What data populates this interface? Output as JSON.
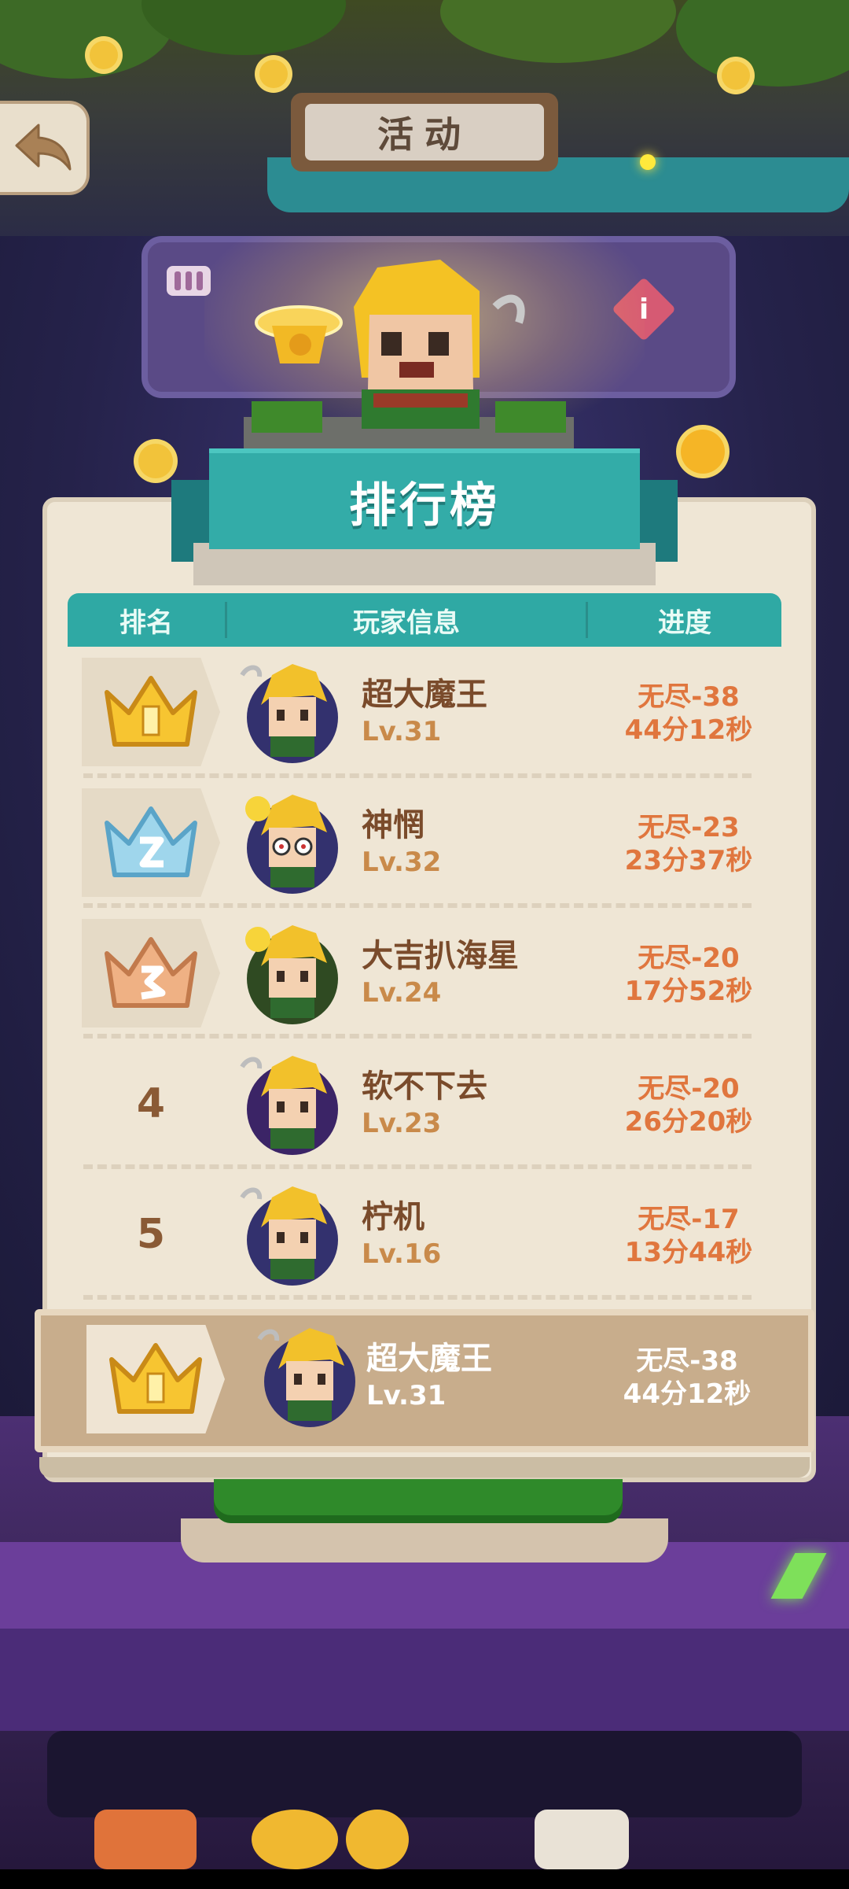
{
  "header": {
    "title": "活动",
    "back_icon": "back-arrow-icon"
  },
  "leaderboard": {
    "title": "排行榜",
    "columns": [
      "排名",
      "玩家信息",
      "进度"
    ],
    "rows": [
      {
        "rank": "1",
        "crown": "gold-crown-icon",
        "name": "超大魔王",
        "level": "Lv.31",
        "progress": "无尽-38",
        "time": "44分12秒"
      },
      {
        "rank": "2",
        "crown": "silver-crown-icon",
        "name": "神惘",
        "level": "Lv.32",
        "progress": "无尽-23",
        "time": "23分37秒"
      },
      {
        "rank": "3",
        "crown": "bronze-crown-icon",
        "name": "大吉扒海星",
        "level": "Lv.24",
        "progress": "无尽-20",
        "time": "17分52秒"
      },
      {
        "rank": "4",
        "crown": "",
        "name": "软不下去",
        "level": "Lv.23",
        "progress": "无尽-20",
        "time": "26分20秒"
      },
      {
        "rank": "5",
        "crown": "",
        "name": "柠机",
        "level": "Lv.16",
        "progress": "无尽-17",
        "time": "13分44秒"
      }
    ],
    "my_rank": {
      "rank": "1",
      "crown": "gold-crown-icon",
      "name": "超大魔王",
      "level": "Lv.31",
      "progress": "无尽-38",
      "time": "44分12秒"
    }
  },
  "colors": {
    "teal": "#33aca8",
    "board": "#efe6d5",
    "name_brown": "#7a4b2b",
    "progress_orange": "#e0763e"
  }
}
